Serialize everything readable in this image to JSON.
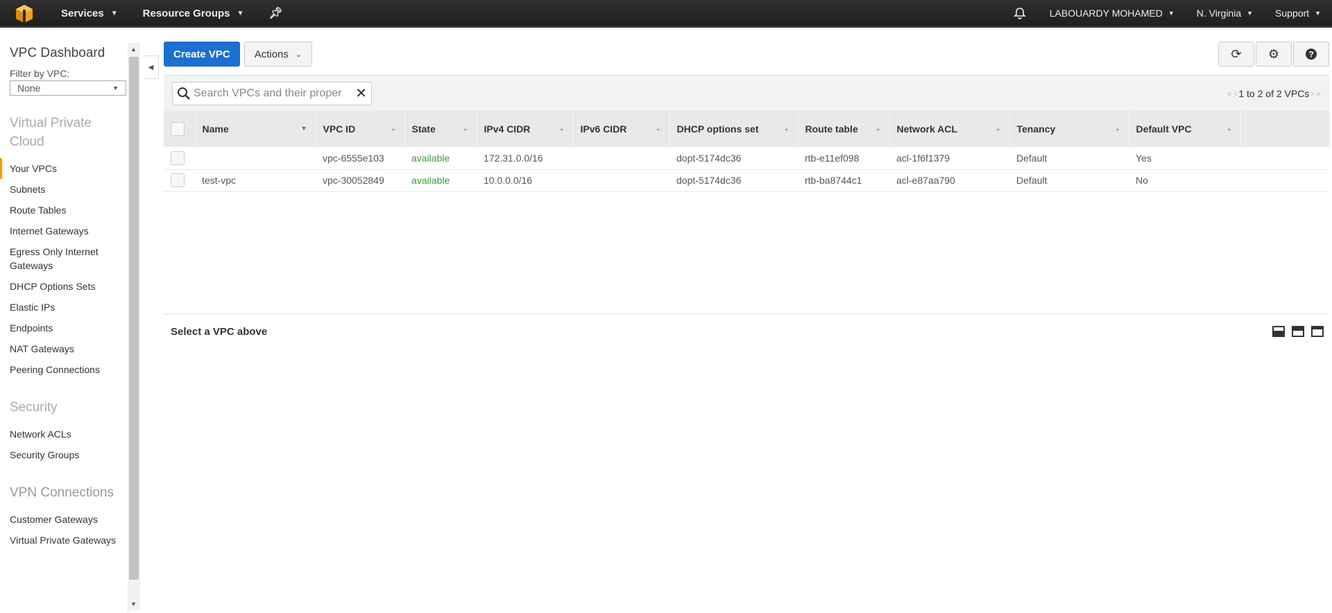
{
  "topnav": {
    "services_label": "Services",
    "resource_groups_label": "Resource Groups",
    "user_label": "LABOUARDY MOHAMED",
    "region_label": "N. Virginia",
    "support_label": "Support"
  },
  "sidebar": {
    "title": "VPC Dashboard",
    "filter_label": "Filter by VPC:",
    "filter_value": "None",
    "sections": [
      {
        "heading": "Virtual Private Cloud",
        "items": [
          {
            "label": "Your VPCs",
            "active": true
          },
          {
            "label": "Subnets"
          },
          {
            "label": "Route Tables"
          },
          {
            "label": "Internet Gateways"
          },
          {
            "label": "Egress Only Internet Gateways"
          },
          {
            "label": "DHCP Options Sets"
          },
          {
            "label": "Elastic IPs"
          },
          {
            "label": "Endpoints"
          },
          {
            "label": "NAT Gateways"
          },
          {
            "label": "Peering Connections"
          }
        ]
      },
      {
        "heading": "Security",
        "items": [
          {
            "label": "Network ACLs"
          },
          {
            "label": "Security Groups"
          }
        ]
      },
      {
        "heading": "VPN Connections",
        "items": [
          {
            "label": "Customer Gateways"
          },
          {
            "label": "Virtual Private Gateways"
          }
        ]
      }
    ]
  },
  "toolbar": {
    "create_label": "Create VPC",
    "actions_label": "Actions"
  },
  "search": {
    "placeholder": "Search VPCs and their proper",
    "pager_text": "1 to 2 of 2 VPCs"
  },
  "table": {
    "columns": [
      "Name",
      "VPC ID",
      "State",
      "IPv4 CIDR",
      "IPv6 CIDR",
      "DHCP options set",
      "Route table",
      "Network ACL",
      "Tenancy",
      "Default VPC"
    ],
    "rows": [
      [
        "",
        "vpc-6555e103",
        "available",
        "172.31.0.0/16",
        "",
        "dopt-5174dc36",
        "rtb-e11ef098",
        "acl-1f6f1379",
        "Default",
        "Yes"
      ],
      [
        "test-vpc",
        "vpc-30052849",
        "available",
        "10.0.0.0/16",
        "",
        "dopt-5174dc36",
        "rtb-ba8744c1",
        "acl-e87aa790",
        "Default",
        "No"
      ]
    ]
  },
  "detail": {
    "message": "Select a VPC above"
  },
  "colors": {
    "primary": "#1a6fd0",
    "available": "#3a9b3a",
    "active_indicator": "#ff9900"
  }
}
